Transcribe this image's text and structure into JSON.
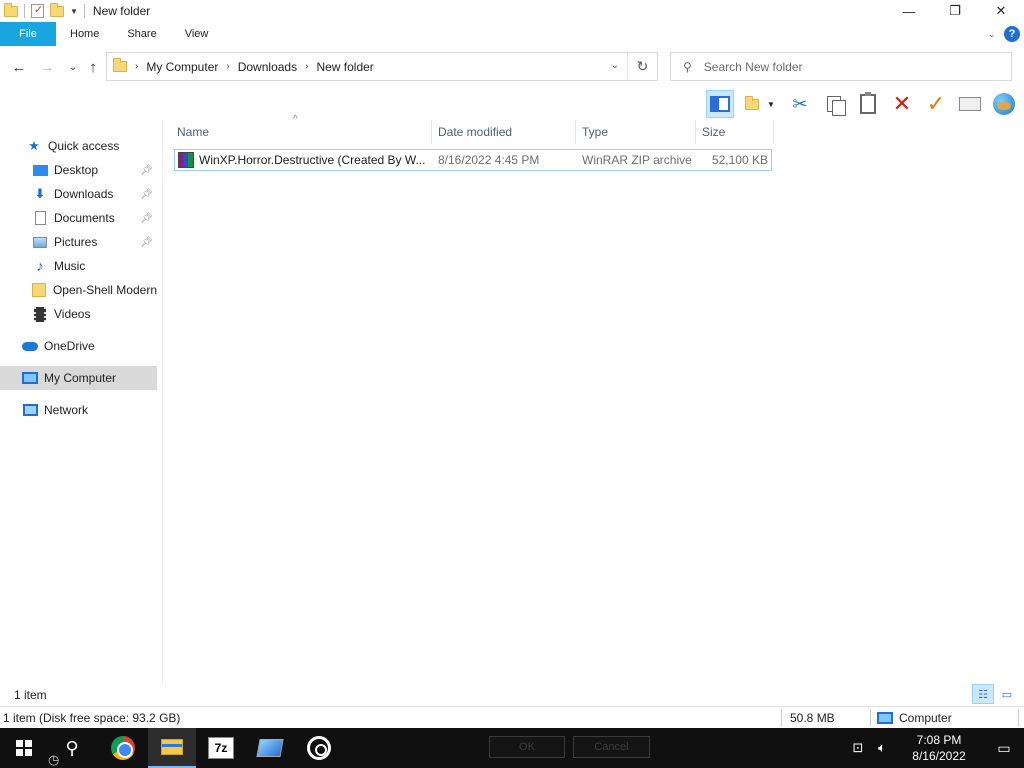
{
  "window": {
    "title": "New folder",
    "controls": {
      "minimize": "—",
      "maximize": "❐",
      "close": "✕"
    }
  },
  "ribbon": {
    "tabs": [
      "File",
      "Home",
      "Share",
      "View"
    ],
    "help": "?"
  },
  "address": {
    "crumbs": [
      "My Computer",
      "Downloads",
      "New folder"
    ]
  },
  "search": {
    "placeholder": "Search New folder"
  },
  "nav": {
    "quick_access": "Quick access",
    "items": [
      {
        "label": "Desktop",
        "pinned": true
      },
      {
        "label": "Downloads",
        "pinned": true
      },
      {
        "label": "Documents",
        "pinned": true
      },
      {
        "label": "Pictures",
        "pinned": true
      },
      {
        "label": "Music",
        "pinned": false
      },
      {
        "label": "Open-Shell Modern",
        "pinned": false
      },
      {
        "label": "Videos",
        "pinned": false
      }
    ],
    "onedrive": "OneDrive",
    "my_computer": "My Computer",
    "network": "Network"
  },
  "filelist": {
    "columns": {
      "name": "Name",
      "date": "Date modified",
      "type": "Type",
      "size": "Size"
    },
    "rows": [
      {
        "name": "WinXP.Horror.Destructive  (Created By W...",
        "date": "8/16/2022 4:45 PM",
        "type": "WinRAR ZIP archive",
        "size": "52,100 KB"
      }
    ]
  },
  "status": {
    "item_count": "1 item",
    "details": "1 item (Disk free space: 93.2 GB)",
    "size": "50.8 MB",
    "location": "Computer"
  },
  "taskbar": {
    "ghost_ok": "OK",
    "ghost_cancel": "Cancel",
    "time": "7:08 PM",
    "date": "8/16/2022"
  },
  "colors": {
    "accent": "#19a6e0",
    "selection": "#cce8ff",
    "selection_border": "#99d1ff",
    "taskbar": "#101010"
  }
}
